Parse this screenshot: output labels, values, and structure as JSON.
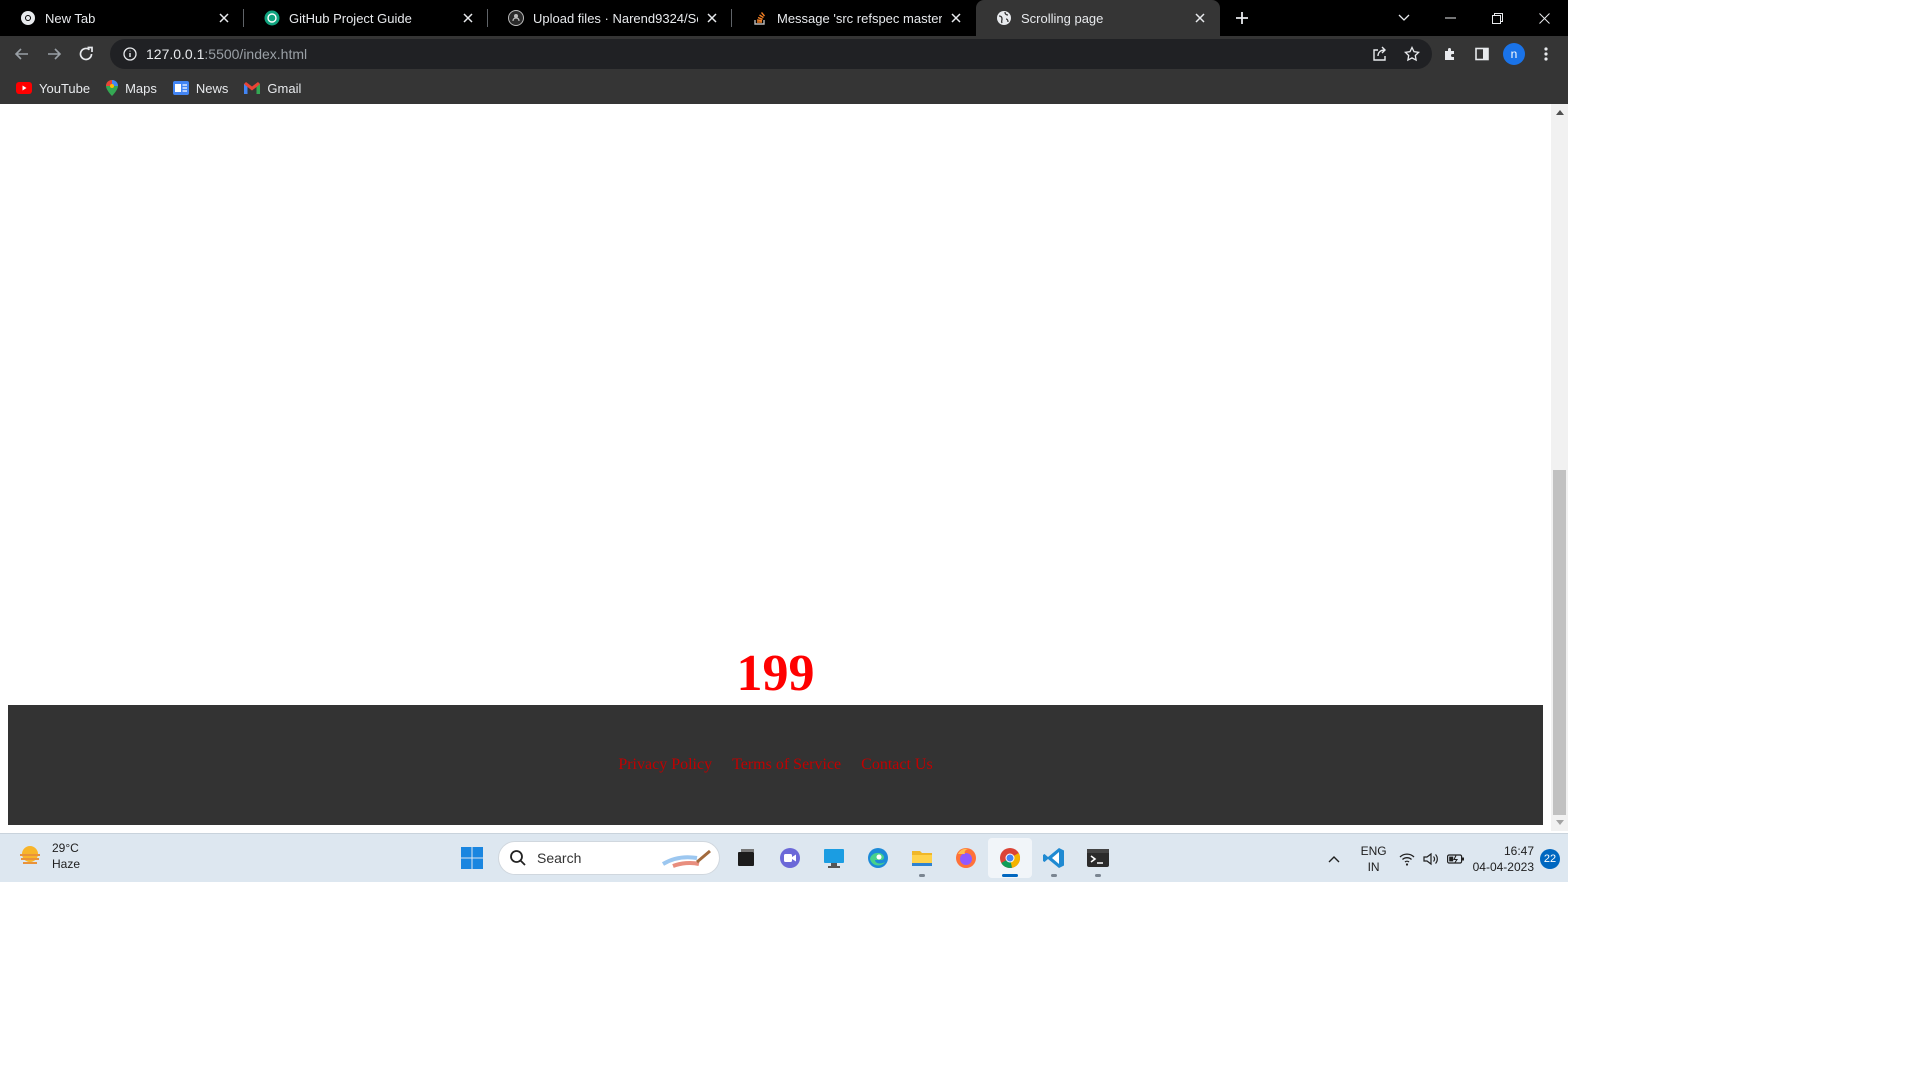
{
  "browser": {
    "tabs": [
      {
        "title": "New Tab",
        "icon": "chrome-icon",
        "active": false
      },
      {
        "title": "GitHub Project Guide",
        "icon": "chatgpt-icon",
        "active": false
      },
      {
        "title": "Upload files · Narend9324/Scrolli",
        "icon": "github-icon",
        "active": false
      },
      {
        "title": "Message 'src refspec master does",
        "icon": "stackoverflow-icon",
        "active": false
      },
      {
        "title": "Scrolling page",
        "icon": "globe-icon",
        "active": true
      }
    ],
    "address_bar": {
      "host": "127.0.0.1",
      "path": ":5500/index.html"
    },
    "profile_initial": "n",
    "bookmarks": [
      {
        "label": "YouTube",
        "icon": "youtube-icon"
      },
      {
        "label": "Maps",
        "icon": "maps-icon"
      },
      {
        "label": "News",
        "icon": "news-icon"
      },
      {
        "label": "Gmail",
        "icon": "gmail-icon"
      }
    ]
  },
  "page": {
    "counter": "199",
    "footer_links": [
      "Privacy Policy",
      "Terms of Service",
      "Contact Us"
    ],
    "colors": {
      "counter": "#ff0000",
      "footer_bg": "#333333",
      "footer_link": "#c10000"
    }
  },
  "taskbar": {
    "weather": {
      "temp": "29°C",
      "condition": "Haze"
    },
    "search_label": "Search",
    "apps": [
      "start-icon",
      "search",
      "task-view-icon",
      "teams-icon",
      "desktop-icon",
      "edge-icon",
      "file-explorer-icon",
      "firefox-icon",
      "chrome-icon",
      "vscode-icon",
      "terminal-icon"
    ],
    "language": {
      "line1": "ENG",
      "line2": "IN"
    },
    "time": "16:47",
    "date": "04-04-2023",
    "notification_count": "22"
  }
}
